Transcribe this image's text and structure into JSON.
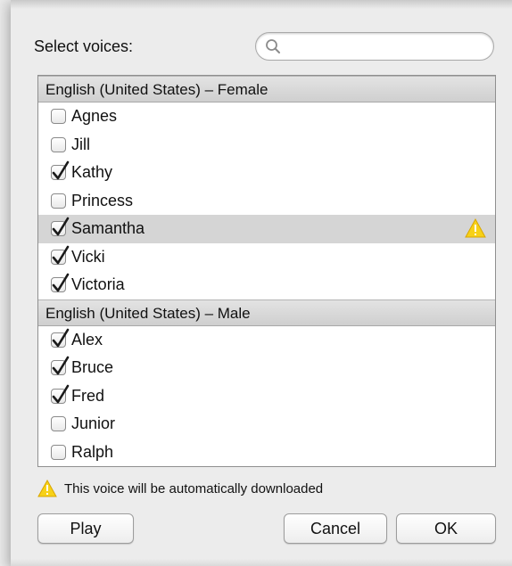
{
  "title": "Select voices:",
  "search": {
    "placeholder": "",
    "value": ""
  },
  "groups": [
    {
      "header": "English (United States) – Female",
      "voices": [
        {
          "name": "Agnes",
          "checked": false,
          "selected": false,
          "warning": false
        },
        {
          "name": "Jill",
          "checked": false,
          "selected": false,
          "warning": false
        },
        {
          "name": "Kathy",
          "checked": true,
          "selected": false,
          "warning": false
        },
        {
          "name": "Princess",
          "checked": false,
          "selected": false,
          "warning": false
        },
        {
          "name": "Samantha",
          "checked": true,
          "selected": true,
          "warning": true
        },
        {
          "name": "Vicki",
          "checked": true,
          "selected": false,
          "warning": false
        },
        {
          "name": "Victoria",
          "checked": true,
          "selected": false,
          "warning": false
        }
      ]
    },
    {
      "header": "English (United States) – Male",
      "voices": [
        {
          "name": "Alex",
          "checked": true,
          "selected": false,
          "warning": false
        },
        {
          "name": "Bruce",
          "checked": true,
          "selected": false,
          "warning": false
        },
        {
          "name": "Fred",
          "checked": true,
          "selected": false,
          "warning": false
        },
        {
          "name": "Junior",
          "checked": false,
          "selected": false,
          "warning": false
        },
        {
          "name": "Ralph",
          "checked": false,
          "selected": false,
          "warning": false
        }
      ]
    }
  ],
  "note": "This voice will be automatically downloaded",
  "buttons": {
    "play": "Play",
    "cancel": "Cancel",
    "ok": "OK"
  },
  "colors": {
    "warning_yellow": "#f7d117",
    "selected_row": "#d5d5d5"
  }
}
